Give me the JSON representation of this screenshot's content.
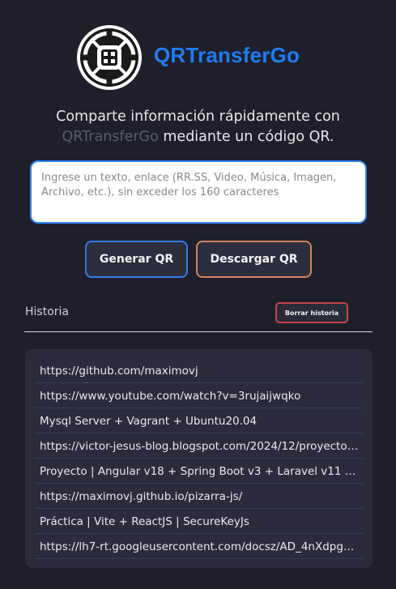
{
  "brand": {
    "name": "QRTransferGo",
    "logo_icon": "qr-transfer-logo-icon",
    "color": "#1f7cf2"
  },
  "tagline": {
    "line1": "Comparte información rápidamente con",
    "brand_ref": "QRTransferGo",
    "line2_rest": " mediante un código QR."
  },
  "input": {
    "value": "",
    "placeholder": "Ingrese un texto, enlace (RR.SS, Video, Música, Imagen, Archivo, etc.), sin exceder los 160 caracteres",
    "accent": "#2f86f6"
  },
  "actions": {
    "generate_label": "Generar QR",
    "download_label": "Descargar QR"
  },
  "history": {
    "title": "Historia",
    "clear_label": "Borrar historia",
    "items": [
      "https://github.com/maximovj",
      "https://www.youtube.com/watch?v=3rujaijwqko",
      "Mysql Server + Vagrant + Ubuntu20.04",
      "https://victor-jesus-blog.blogspot.com/2024/12/proyecto-…",
      "Proyecto | Angular v18 + Spring Boot v3 + Laravel v11 | L…",
      "https://maximovj.github.io/pizarra-js/",
      "Práctica | Vite + ReactJS | SecureKeyJs",
      "https://lh7-rt.googleusercontent.com/docsz/AD_4nXdpgn…"
    ]
  }
}
